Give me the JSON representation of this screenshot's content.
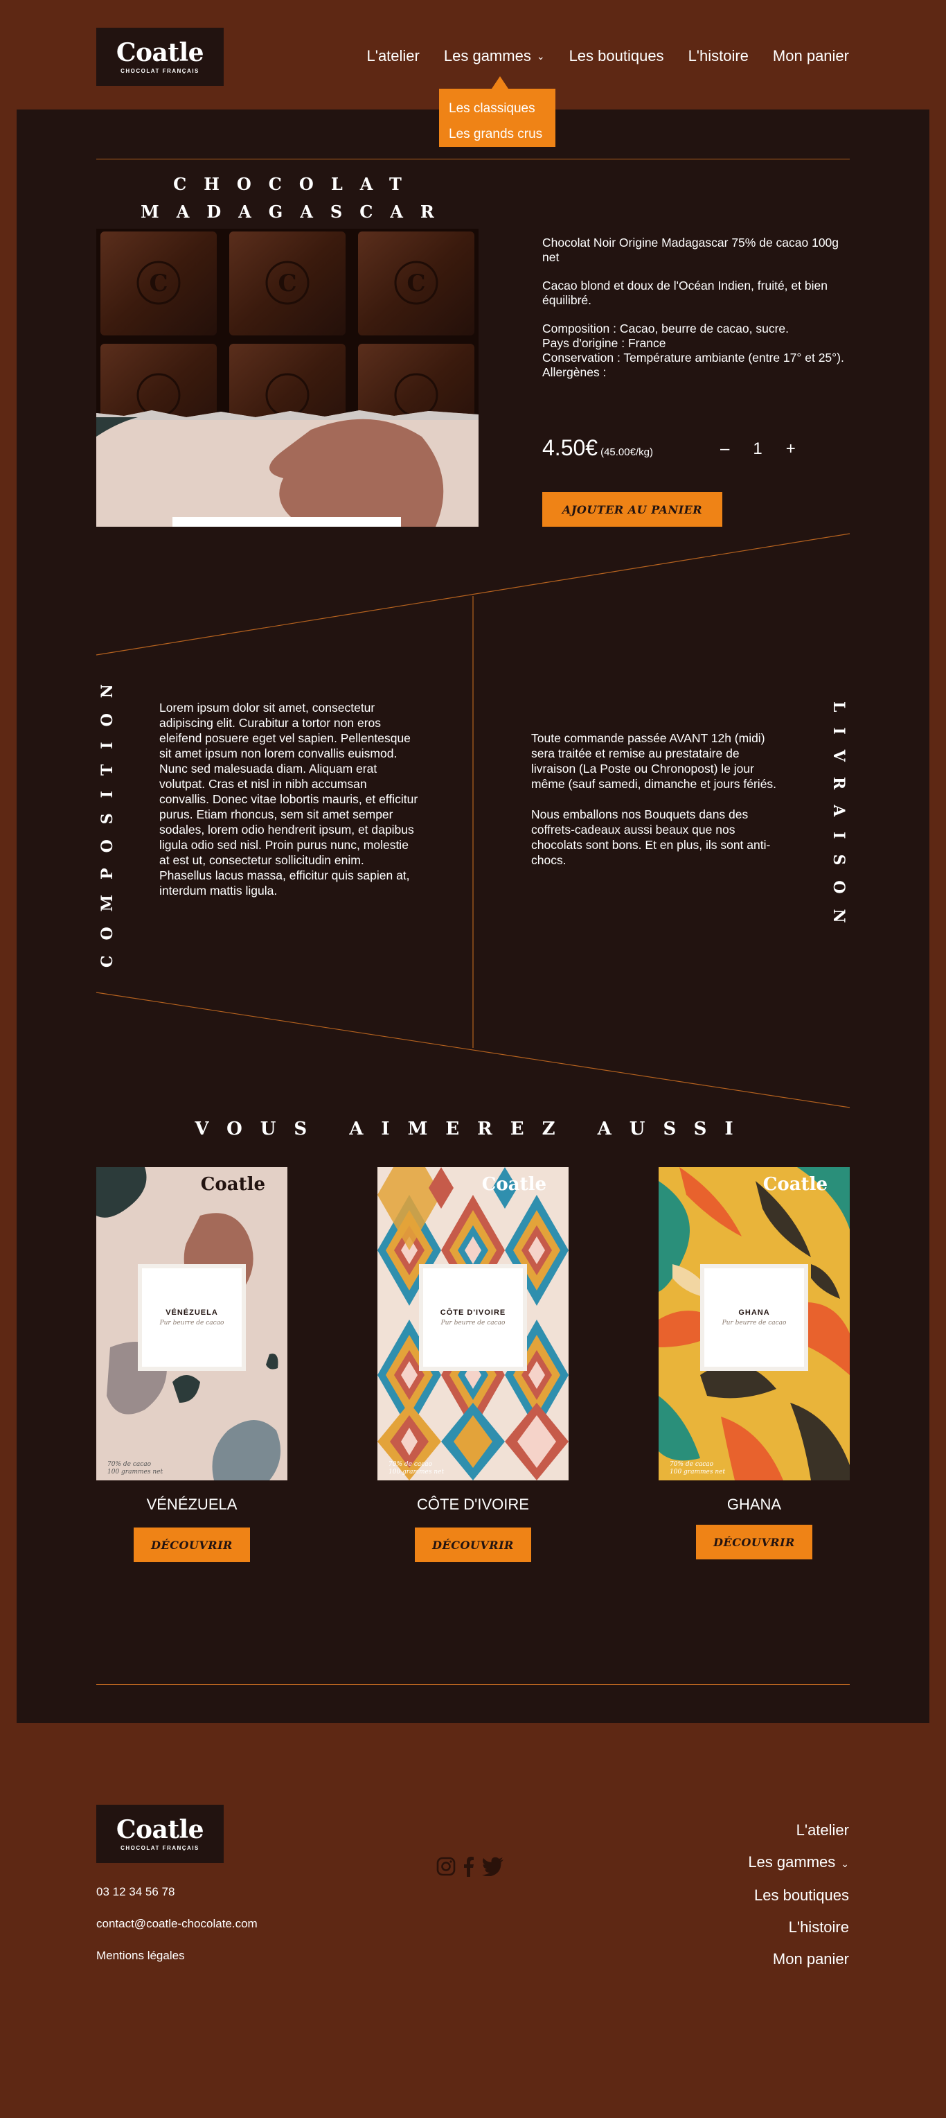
{
  "brand": {
    "name": "Coatle",
    "tagline": "CHOCOLAT FRANÇAIS"
  },
  "nav": {
    "items": [
      "L'atelier",
      "Les gammes",
      "Les boutiques",
      "L'histoire",
      "Mon panier"
    ],
    "dropdown": [
      "Les classiques",
      "Les grands crus"
    ]
  },
  "product": {
    "title_line1": "CHOCOLAT",
    "title_line2": "MADAGASCAR",
    "name": "Chocolat Noir Origine Madagascar 75% de cacao 100g net",
    "tagline": "Cacao blond et doux de l'Océan Indien, fruité, et bien équilibré.",
    "composition": "Composition : Cacao, beurre de cacao, sucre.",
    "origin": "Pays d'origine : France",
    "storage": "Conservation : Température ambiante (entre 17° et 25°).",
    "allergens": "Allergènes :",
    "price": "4.50€",
    "price_per_kg": "(45.00€/kg)",
    "qty_minus": "–",
    "quantity": "1",
    "qty_plus": "+",
    "add_to_cart": "AJOUTER AU PANIER"
  },
  "composition_section": {
    "heading": "COMPOSITION",
    "text": "Lorem ipsum dolor sit amet, consectetur adipiscing elit. Curabitur a tortor non eros eleifend posuere eget vel sapien. Pellentesque sit amet ipsum non lorem convallis euismod. Nunc sed malesuada diam. Aliquam erat volutpat. Cras et nisl in nibh accumsan convallis. Donec vitae lobortis mauris, et efficitur purus. Etiam rhoncus, sem sit amet semper sodales, lorem odio hendrerit ipsum, et dapibus ligula odio sed nisl. Proin purus nunc, molestie at est ut, consectetur sollicitudin enim. Phasellus lacus massa, efficitur quis sapien at, interdum mattis ligula."
  },
  "delivery_section": {
    "heading": "LIVRAISON",
    "text1": "Toute commande passée AVANT 12h (midi) sera traitée et remise au prestataire de livraison (La Poste ou Chronopost) le jour même (sauf samedi, dimanche et jours fériés.",
    "text2": "Nous emballons nos Bouquets dans des coffrets-cadeaux aussi beaux que nos chocolats sont bons. Et en plus, ils sont anti-chocs."
  },
  "recommendations": {
    "title": "VOUS AIMEREZ AUSSI",
    "items": [
      {
        "label": "VÉNÉZUELA",
        "name": "VÉNÉZUELA",
        "subtitle": "Pur beurre de cacao",
        "foot1": "70% de cacao",
        "foot2": "100 grammes net",
        "button": "DÉCOUVRIR"
      },
      {
        "label": "CÔTE D'IVOIRE",
        "name": "CÔTE D'IVOIRE",
        "subtitle": "Pur beurre de cacao",
        "foot1": "70% de cacao",
        "foot2": "100 grammes net",
        "button": "DÉCOUVRIR"
      },
      {
        "label": "GHANA",
        "name": "GHANA",
        "subtitle": "Pur beurre de cacao",
        "foot1": "70% de cacao",
        "foot2": "100 grammes net",
        "button": "DÉCOUVRIR"
      }
    ]
  },
  "footer": {
    "phone": "03 12 34 56 78",
    "email": "contact@coatle-chocolate.com",
    "legal": "Mentions légales",
    "nav": [
      "L'atelier",
      "Les gammes",
      "Les boutiques",
      "L'histoire",
      "Mon panier"
    ],
    "social": [
      "instagram-icon",
      "facebook-icon",
      "twitter-icon"
    ]
  },
  "colors": {
    "background": "#5e2814",
    "panel": "#221310",
    "accent": "#ef8316",
    "rule": "#b5621f"
  }
}
